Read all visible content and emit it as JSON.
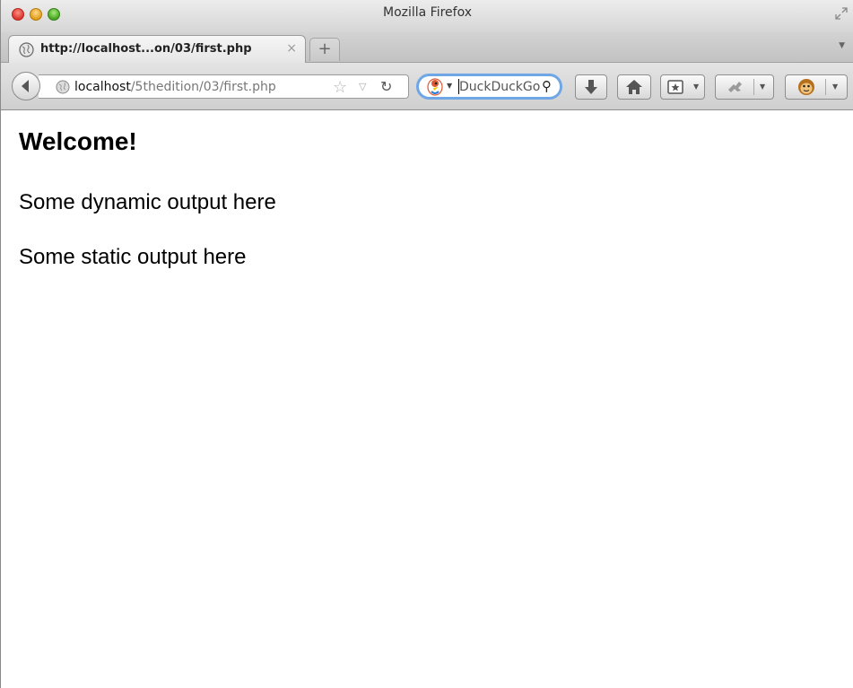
{
  "window": {
    "title": "Mozilla Firefox"
  },
  "tab": {
    "title": "http://localhost...on/03/first.php",
    "close_glyph": "×"
  },
  "new_tab": {
    "glyph": "+"
  },
  "address_bar": {
    "host": "localhost",
    "path": "/5thedition/03/first.php"
  },
  "search_bar": {
    "engine": "DuckDuckGo",
    "placeholder": "DuckDuckGo"
  },
  "page": {
    "heading": "Welcome!",
    "paragraphs": [
      "Some dynamic output here",
      "Some static output here"
    ]
  },
  "icons": {
    "back": "back-arrow-icon",
    "site": "globe-icon",
    "bookmark": "star-icon",
    "reload": "reload-icon",
    "search": "magnifier-icon",
    "downloads": "download-icon",
    "home": "home-icon",
    "bookmarks_menu": "bookmarks-icon",
    "addon": "addon-icon",
    "avatar": "monkey-face-icon"
  },
  "colors": {
    "search_focus": "#6fa6e6",
    "close": "#d9352b",
    "minimize": "#e19d17",
    "maximize": "#47a51f"
  }
}
